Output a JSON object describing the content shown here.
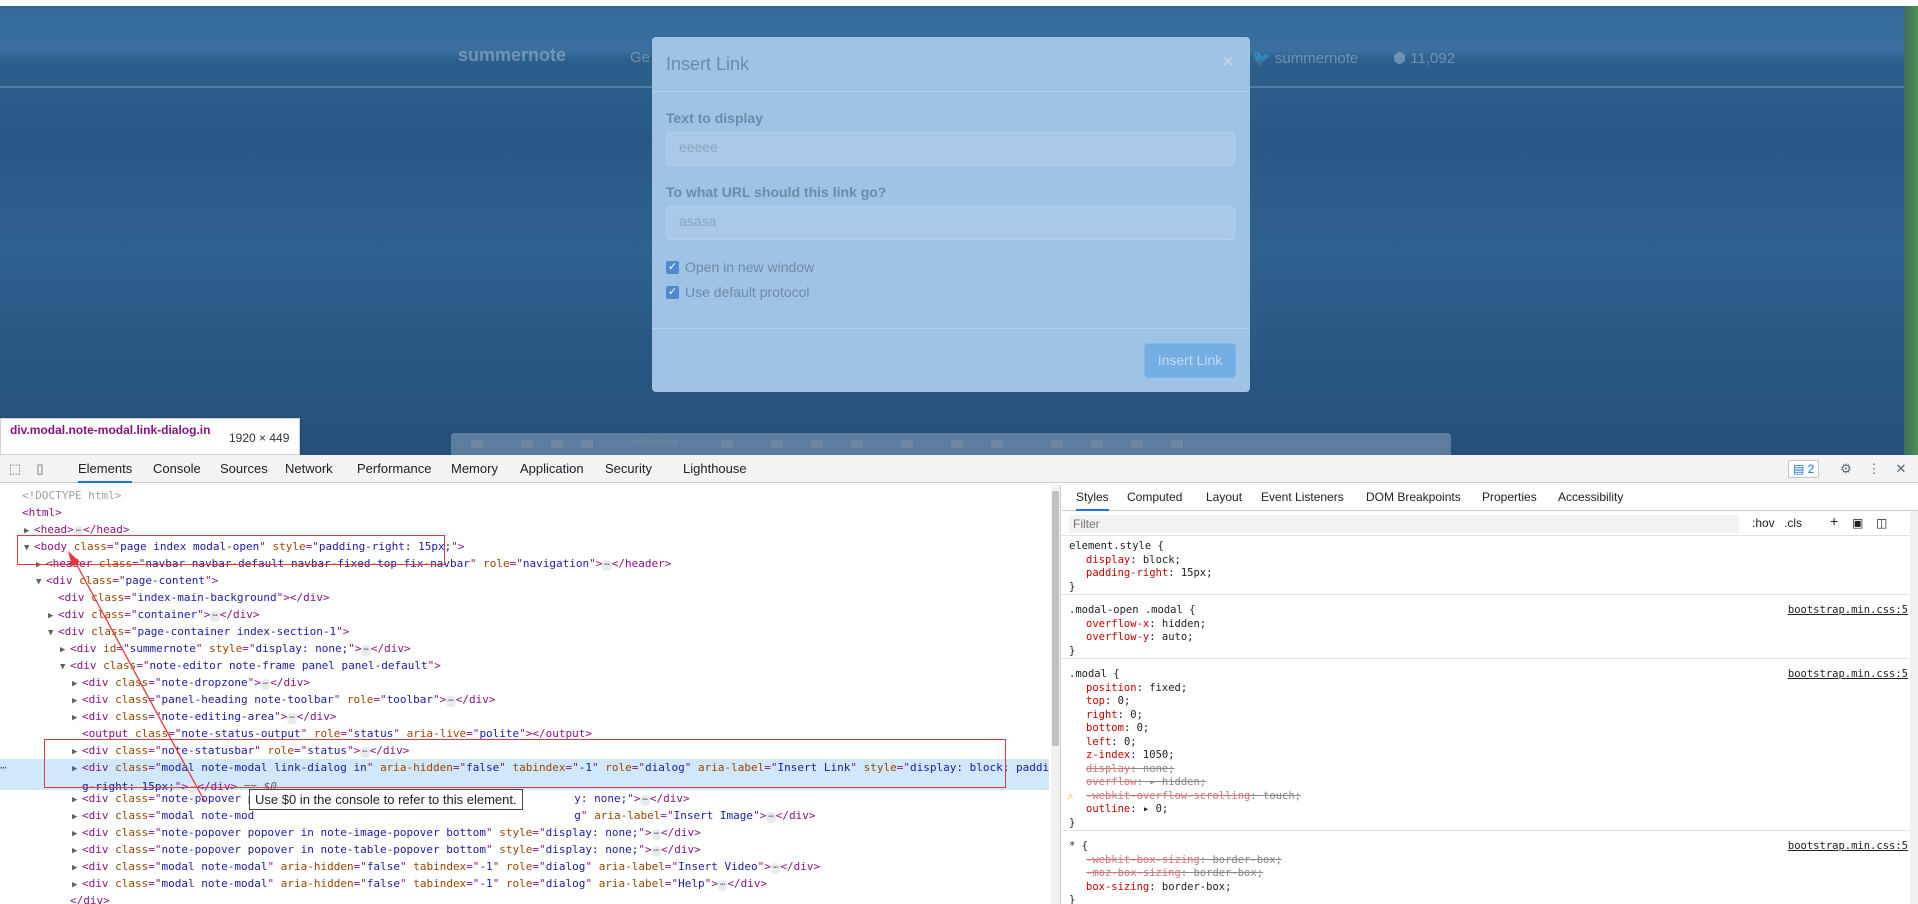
{
  "webpage": {
    "nav": {
      "brand": "summernote",
      "item_partial": "Ge",
      "twitter": "summernote",
      "stars": "11,092"
    },
    "toolbar_style": "Helvetica"
  },
  "modal": {
    "title": "Insert Link",
    "close_glyph": "×",
    "text_label": "Text to display",
    "text_value": "eeeee",
    "url_label": "To what URL should this link go?",
    "url_value": "asasa",
    "check_new_window": "Open in new window",
    "check_default_protocol": "Use default protocol",
    "submit_label": "Insert Link"
  },
  "inspect_tooltip": {
    "selector": "div.modal.note-modal.link-dialog.in",
    "dimensions": "1920 × 449"
  },
  "devtools": {
    "tabs": [
      "Elements",
      "Console",
      "Sources",
      "Network",
      "Performance",
      "Memory",
      "Application",
      "Security",
      "Lighthouse"
    ],
    "active_tab": "Elements",
    "issues_count": "2",
    "console_tip": "Use $0 in the console to refer to this element.",
    "dom_lines": [
      {
        "indent": 0,
        "tri": "",
        "html": "<span class='dt'>&lt;!DOCTYPE html&gt;</span>"
      },
      {
        "indent": 0,
        "tri": "",
        "html": "<span class='tg'>&lt;html&gt;</span>"
      },
      {
        "indent": 1,
        "tri": "▶",
        "html": "<span class='tg'>&lt;head&gt;</span><span class='ell'>⋯</span><span class='tg'>&lt;/head&gt;</span>"
      },
      {
        "indent": 1,
        "tri": "▼",
        "html": "<span class='tg'>&lt;body </span><span class='an'>class</span><span class='tg'>=\"</span><span class='av'>page index modal-open</span><span class='tg'>\" </span><span class='an'>style</span><span class='tg'>=\"</span><span class='av'>padding-right: 15px;</span><span class='tg'>\"&gt;</span>"
      },
      {
        "indent": 2,
        "tri": "▶",
        "html": "<span class='tg'>&lt;header </span><span class='an'>class</span><span class='tg'>=\"</span><span class='av'>navbar navbar-default navbar-fixed-top fix-navbar</span><span class='tg'>\" </span><span class='an'>role</span><span class='tg'>=\"</span><span class='av'>navigation</span><span class='tg'>\"&gt;</span><span class='ell'>⋯</span><span class='tg'>&lt;/header&gt;</span>"
      },
      {
        "indent": 2,
        "tri": "▼",
        "html": "<span class='tg'>&lt;div </span><span class='an'>class</span><span class='tg'>=\"</span><span class='av'>page-content</span><span class='tg'>\"&gt;</span>"
      },
      {
        "indent": 3,
        "tri": "",
        "html": "<span class='tg'>&lt;div </span><span class='an'>class</span><span class='tg'>=\"</span><span class='av'>index-main-background</span><span class='tg'>\"&gt;&lt;/div&gt;</span>"
      },
      {
        "indent": 3,
        "tri": "▶",
        "html": "<span class='tg'>&lt;div </span><span class='an'>class</span><span class='tg'>=\"</span><span class='av'>container</span><span class='tg'>\"&gt;</span><span class='ell'>⋯</span><span class='tg'>&lt;/div&gt;</span>"
      },
      {
        "indent": 3,
        "tri": "▼",
        "html": "<span class='tg'>&lt;div </span><span class='an'>class</span><span class='tg'>=\"</span><span class='av'>page-container index-section-1</span><span class='tg'>\"&gt;</span>"
      },
      {
        "indent": 4,
        "tri": "▶",
        "html": "<span class='tg'>&lt;div </span><span class='an'>id</span><span class='tg'>=\"</span><span class='av'>summernote</span><span class='tg'>\" </span><span class='an'>style</span><span class='tg'>=\"</span><span class='av'>display: none;</span><span class='tg'>\"&gt;</span><span class='ell'>⋯</span><span class='tg'>&lt;/div&gt;</span>"
      },
      {
        "indent": 4,
        "tri": "▼",
        "html": "<span class='tg'>&lt;div </span><span class='an'>class</span><span class='tg'>=\"</span><span class='av'>note-editor note-frame panel panel-default</span><span class='tg'>\"&gt;</span>"
      },
      {
        "indent": 5,
        "tri": "▶",
        "html": "<span class='tg'>&lt;div </span><span class='an'>class</span><span class='tg'>=\"</span><span class='av'>note-dropzone</span><span class='tg'>\"&gt;</span><span class='ell'>⋯</span><span class='tg'>&lt;/div&gt;</span>"
      },
      {
        "indent": 5,
        "tri": "▶",
        "html": "<span class='tg'>&lt;div </span><span class='an'>class</span><span class='tg'>=\"</span><span class='av'>panel-heading note-toolbar</span><span class='tg'>\" </span><span class='an'>role</span><span class='tg'>=\"</span><span class='av'>toolbar</span><span class='tg'>\"&gt;</span><span class='ell'>⋯</span><span class='tg'>&lt;/div&gt;</span>"
      },
      {
        "indent": 5,
        "tri": "▶",
        "html": "<span class='tg'>&lt;div </span><span class='an'>class</span><span class='tg'>=\"</span><span class='av'>note-editing-area</span><span class='tg'>\"&gt;</span><span class='ell'>⋯</span><span class='tg'>&lt;/div&gt;</span>"
      },
      {
        "indent": 5,
        "tri": "",
        "html": "<span class='tg'>&lt;output </span><span class='an'>class</span><span class='tg'>=\"</span><span class='av'>note-status-output</span><span class='tg'>\" </span><span class='an'>role</span><span class='tg'>=\"</span><span class='av'>status</span><span class='tg'>\" </span><span class='an'>aria-live</span><span class='tg'>=\"</span><span class='av'>polite</span><span class='tg'>\"&gt;&lt;/output&gt;</span>"
      },
      {
        "indent": 5,
        "tri": "▶",
        "html": "<span class='tg'>&lt;div </span><span class='an'>class</span><span class='tg'>=\"</span><span class='av'>note-statusbar</span><span class='tg'>\" </span><span class='an'>role</span><span class='tg'>=\"</span><span class='av'>status</span><span class='tg'>\"&gt;</span><span class='ell'>⋯</span><span class='tg'>&lt;/div&gt;</span>"
      },
      {
        "indent": 5,
        "tri": "▶",
        "selected": true,
        "html": "<span class='tg'>&lt;div </span><span class='an'>class</span><span class='tg'>=\"</span><span class='av'>modal note-modal link-dialog in</span><span class='tg'>\" </span><span class='an'>aria-hidden</span><span class='tg'>=\"</span><span class='av'>false</span><span class='tg'>\" </span><span class='an'>tabindex</span><span class='tg'>=\"</span><span class='av'>-1</span><span class='tg'>\" </span><span class='an'>role</span><span class='tg'>=\"</span><span class='av'>dialog</span><span class='tg'>\" </span><span class='an'>aria-label</span><span class='tg'>=\"</span><span class='av'>Insert Link</span><span class='tg'>\" </span><span class='an'>style</span><span class='tg'>=\"</span><span class='av'>display: block; paddin</span>",
        "html2": "<span class='av'>g-right: 15px;</span><span class='tg'>\"&gt;</span><span class='ell'>⋯</span><span class='tg'>&lt;/div&gt;</span> <span class='sel-eq'>== $0</span>"
      },
      {
        "indent": 5,
        "tri": "▶",
        "html": "<span class='tg'>&lt;div </span><span class='an'>class</span><span class='tg'>=\"</span><span class='av'>note-popover p</span><span style='display:inline-block;width:320px'></span><span class='av'>y: none;</span><span class='tg'>\"&gt;</span><span class='ell'>⋯</span><span class='tg'>&lt;/div&gt;</span>"
      },
      {
        "indent": 5,
        "tri": "▶",
        "html": "<span class='tg'>&lt;div </span><span class='an'>class</span><span class='tg'>=\"</span><span class='av'>modal note-mod</span><span style='display:inline-block;width:320px'></span><span class='av'>g</span><span class='tg'>\" </span><span class='an'>aria-label</span><span class='tg'>=\"</span><span class='av'>Insert Image</span><span class='tg'>\"&gt;</span><span class='ell'>⋯</span><span class='tg'>&lt;/div&gt;</span>"
      },
      {
        "indent": 5,
        "tri": "▶",
        "html": "<span class='tg'>&lt;div </span><span class='an'>class</span><span class='tg'>=\"</span><span class='av'>note-popover popover in note-image-popover bottom</span><span class='tg'>\" </span><span class='an'>style</span><span class='tg'>=\"</span><span class='av'>display: none;</span><span class='tg'>\"&gt;</span><span class='ell'>⋯</span><span class='tg'>&lt;/div&gt;</span>"
      },
      {
        "indent": 5,
        "tri": "▶",
        "html": "<span class='tg'>&lt;div </span><span class='an'>class</span><span class='tg'>=\"</span><span class='av'>note-popover popover in note-table-popover bottom</span><span class='tg'>\" </span><span class='an'>style</span><span class='tg'>=\"</span><span class='av'>display: none;</span><span class='tg'>\"&gt;</span><span class='ell'>⋯</span><span class='tg'>&lt;/div&gt;</span>"
      },
      {
        "indent": 5,
        "tri": "▶",
        "html": "<span class='tg'>&lt;div </span><span class='an'>class</span><span class='tg'>=\"</span><span class='av'>modal note-modal</span><span class='tg'>\" </span><span class='an'>aria-hidden</span><span class='tg'>=\"</span><span class='av'>false</span><span class='tg'>\" </span><span class='an'>tabindex</span><span class='tg'>=\"</span><span class='av'>-1</span><span class='tg'>\" </span><span class='an'>role</span><span class='tg'>=\"</span><span class='av'>dialog</span><span class='tg'>\" </span><span class='an'>aria-label</span><span class='tg'>=\"</span><span class='av'>Insert Video</span><span class='tg'>\"&gt;</span><span class='ell'>⋯</span><span class='tg'>&lt;/div&gt;</span>"
      },
      {
        "indent": 5,
        "tri": "▶",
        "html": "<span class='tg'>&lt;div </span><span class='an'>class</span><span class='tg'>=\"</span><span class='av'>modal note-modal</span><span class='tg'>\" </span><span class='an'>aria-hidden</span><span class='tg'>=\"</span><span class='av'>false</span><span class='tg'>\" </span><span class='an'>tabindex</span><span class='tg'>=\"</span><span class='av'>-1</span><span class='tg'>\" </span><span class='an'>role</span><span class='tg'>=\"</span><span class='av'>dialog</span><span class='tg'>\" </span><span class='an'>aria-label</span><span class='tg'>=\"</span><span class='av'>Help</span><span class='tg'>\"&gt;</span><span class='ell'>⋯</span><span class='tg'>&lt;/div&gt;</span>"
      },
      {
        "indent": 4,
        "tri": "",
        "html": "<span class='tg'>&lt;/div&gt;</span>"
      }
    ],
    "styles_tabs": [
      "Styles",
      "Computed",
      "Layout",
      "Event Listeners",
      "DOM Breakpoints",
      "Properties",
      "Accessibility"
    ],
    "active_styles_tab": "Styles",
    "filter_placeholder": "Filter",
    "hov_label": ":hov",
    "cls_label": ".cls",
    "plus_label": "+",
    "css_rules": [
      {
        "selector": "element.style {",
        "source": "",
        "props": [
          {
            "name": "display",
            "value": "block;",
            "struck": false
          },
          {
            "name": "padding-right",
            "value": "15px;",
            "struck": false
          }
        ]
      },
      {
        "selector": ".modal-open .modal {",
        "source": "bootstrap.min.css:5",
        "props": [
          {
            "name": "overflow-x",
            "value": "hidden;",
            "struck": false
          },
          {
            "name": "overflow-y",
            "value": "auto;",
            "struck": false
          }
        ]
      },
      {
        "selector": ".modal {",
        "source": "bootstrap.min.css:5",
        "props": [
          {
            "name": "position",
            "value": "fixed;",
            "struck": false
          },
          {
            "name": "top",
            "value": "0;",
            "struck": false
          },
          {
            "name": "right",
            "value": "0;",
            "struck": false
          },
          {
            "name": "bottom",
            "value": "0;",
            "struck": false
          },
          {
            "name": "left",
            "value": "0;",
            "struck": false
          },
          {
            "name": "z-index",
            "value": "1050;",
            "struck": false
          },
          {
            "name": "display",
            "value": "none;",
            "struck": true
          },
          {
            "name": "overflow",
            "value": "▸ hidden;",
            "struck": true
          },
          {
            "name": "-webkit-overflow-scrolling",
            "value": "touch;",
            "struck": true,
            "warn": true
          },
          {
            "name": "outline",
            "value": "▸ 0;",
            "struck": false
          }
        ]
      },
      {
        "selector": "* {",
        "source": "bootstrap.min.css:5",
        "props": [
          {
            "name": "-webkit-box-sizing",
            "value": "border-box;",
            "struck": true
          },
          {
            "name": "-moz-box-sizing",
            "value": "border-box;",
            "struck": true
          },
          {
            "name": "box-sizing",
            "value": "border-box;",
            "struck": false
          }
        ]
      }
    ]
  }
}
